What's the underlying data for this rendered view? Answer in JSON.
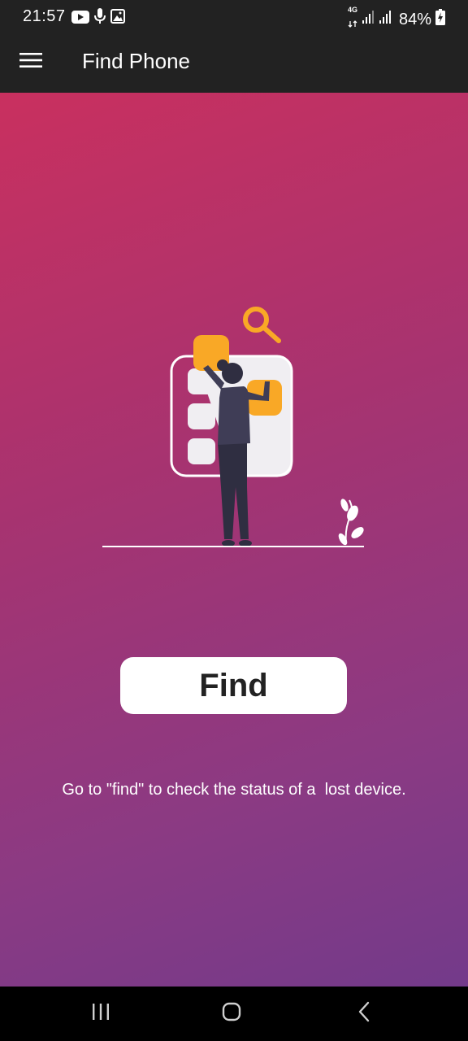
{
  "status_bar": {
    "time": "21:57",
    "network_type": "4G",
    "battery_percent": "84%",
    "left_icons": [
      "youtube-icon",
      "microphone-icon",
      "image-icon"
    ],
    "right_icons": [
      "network-4g-icon",
      "signal-icon",
      "signal-icon",
      "battery-charging-icon"
    ]
  },
  "app_bar": {
    "title": "Find Phone",
    "menu_icon": "hamburger-menu-icon",
    "background": "#222222"
  },
  "main": {
    "illustration": "person-searching-apps-illustration",
    "find_button_label": "Find",
    "hint": "Go to \"find\" to check the status of a  lost device.",
    "gradient_colors": [
      "#c9305f",
      "#a73370",
      "#8b3a83",
      "#733a8a"
    ],
    "accent_color": "#f9a826"
  },
  "nav_bar": {
    "icons": [
      "recent-apps-icon",
      "home-icon",
      "back-icon"
    ]
  }
}
